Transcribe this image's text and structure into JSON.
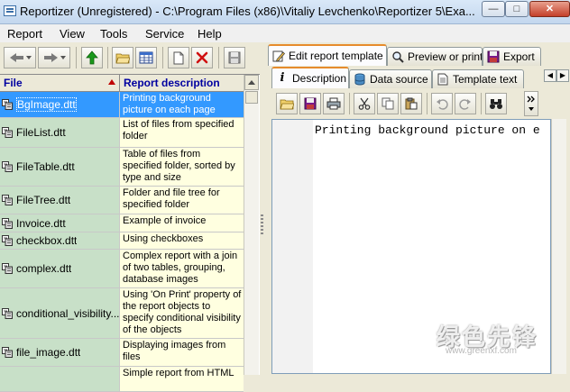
{
  "window": {
    "title": "Reportizer (Unregistered) - C:\\Program Files (x86)\\Vitaliy Levchenko\\Reportizer 5\\Exa..."
  },
  "menu": [
    {
      "label": "Report"
    },
    {
      "label": "View"
    },
    {
      "label": "Tools"
    },
    {
      "label": "Service"
    },
    {
      "label": "Help"
    }
  ],
  "grid": {
    "header_file": "File",
    "header_desc": "Report description",
    "rows": [
      {
        "file": "BgImage.dtt",
        "desc": "Printing background picture on each page"
      },
      {
        "file": "FileList.dtt",
        "desc": "List of files from specified folder"
      },
      {
        "file": "FileTable.dtt",
        "desc": "Table of files from specified folder, sorted by type and size"
      },
      {
        "file": "FileTree.dtt",
        "desc": "Folder and file tree for specified folder"
      },
      {
        "file": "Invoice.dtt",
        "desc": "Example of invoice"
      },
      {
        "file": "checkbox.dtt",
        "desc": "Using checkboxes"
      },
      {
        "file": "complex.dtt",
        "desc": "Complex report with a join of two tables, grouping, database images"
      },
      {
        "file": "conditional_visibility....",
        "desc": "Using 'On Print' property of the report objects to specify conditional visibility of the objects"
      },
      {
        "file": "file_image.dtt",
        "desc": "Displaying images from files"
      },
      {
        "file": "",
        "desc": "Simple report from HTML"
      }
    ]
  },
  "right_tabs": [
    {
      "label": "Edit report template"
    },
    {
      "label": "Preview or print"
    },
    {
      "label": "Export"
    }
  ],
  "sub_tabs": [
    {
      "label": "Description"
    },
    {
      "label": "Data source"
    },
    {
      "label": "Template text"
    }
  ],
  "editor": {
    "content": "Printing background picture on e"
  },
  "watermark": {
    "big": "绿色先锋",
    "small": "www.greenxf.com"
  },
  "colors": {
    "selected_row": "#3399ff",
    "file_cell": "#c8e0c8",
    "desc_cell": "#ffffe0",
    "header_text": "#0000a0"
  }
}
